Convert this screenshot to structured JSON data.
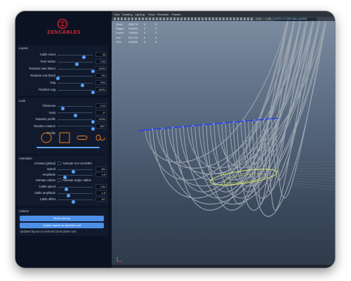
{
  "app": {
    "logo_text": "ZENCABLES",
    "logo_color": "#cc1f2a",
    "accent_color": "#4d8fe8"
  },
  "layout_section": {
    "title": "Layout",
    "rows": [
      {
        "label": "Cable count",
        "value": "35",
        "level": 0.75
      },
      {
        "label": "Root radius",
        "value": "2.00",
        "level": 0.55
      },
      {
        "label": "Random start (Blue)",
        "value": "100%",
        "level": 1.0
      },
      {
        "label": "Random end (Red)",
        "value": "0%",
        "level": 0.0
      },
      {
        "label": "Sag",
        "value": "70%",
        "level": 0.7
      },
      {
        "label": "Random sag",
        "value": "100%",
        "level": 1.0
      }
    ]
  },
  "look_section": {
    "title": "Look",
    "rows": [
      {
        "label": "Thickness",
        "value": "0.22",
        "level": 0.15
      },
      {
        "label": "Twist",
        "value": "0°",
        "level": 0.5
      },
      {
        "label": "Random profile",
        "value": "100%",
        "level": 1.0
      },
      {
        "label": "Random rotation",
        "value": "180°",
        "level": 1.0
      }
    ],
    "profile_label": "Profile",
    "profiles": [
      "circle-profile",
      "square-profile",
      "rounded-rect-profile",
      "loop-profile"
    ]
  },
  "animation_section": {
    "title": "Animation",
    "animate_global_label": "Animate (global)",
    "animate_global_hint": "Animate root controller",
    "speed": {
      "label": "Speed",
      "value": "10x",
      "level": 0.45
    },
    "amplitude": {
      "label": "Amplitude",
      "value": "0.5",
      "level": 0.2
    },
    "animate_cables_label": "Animate cables",
    "animate_cables_hint": "Animate single cables",
    "cable_speed": {
      "label": "Cable speed",
      "value": "2.5x",
      "level": 0.25
    },
    "cable_amplitude": {
      "label": "Cable amplitude",
      "value": "1.5",
      "level": 0.3
    },
    "cable_offset": {
      "label": "Cable offset",
      "value": "19°",
      "level": 0.45
    }
  },
  "actions_section": {
    "title": "Actions",
    "build_button": "Build new rig",
    "update_button": "Update layout on selected root",
    "status": "Updated layout on selected ZenCables root"
  },
  "viewport": {
    "menu": [
      "View",
      "Shading",
      "Lighting",
      "Show",
      "Renderer",
      "Panels"
    ],
    "camera_field": "ACES 1.0 SDR-video (sRGB)",
    "frame_number": "0.00",
    "zoom": "1.00",
    "hud": [
      [
        "Verts:",
        "265170",
        "0",
        "0"
      ],
      [
        "Edges:",
        "530040",
        "0",
        "0"
      ],
      [
        "Faces:",
        "793800",
        "0",
        "0"
      ],
      [
        "Tris:",
        "531720",
        "0",
        "0"
      ],
      [
        "UVs:",
        "282528",
        "0",
        "0"
      ]
    ],
    "background_top": "#7f8fa3",
    "background_bottom": "#2f3a4a",
    "cable_color": "#9aa3ad",
    "rail_color": "#1f3cff",
    "control_color": "#d9e86a"
  }
}
